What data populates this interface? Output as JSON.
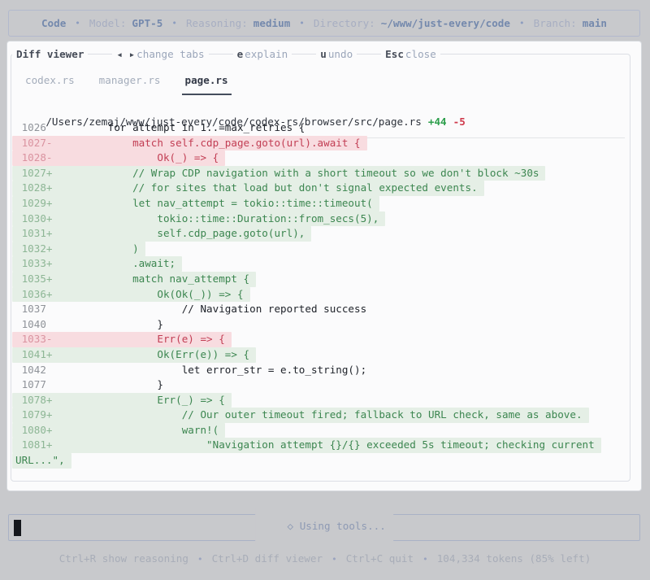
{
  "topbar": {
    "app": "Code",
    "bullet": "•",
    "items": [
      {
        "label": "Model:",
        "value": "GPT-5"
      },
      {
        "label": "Reasoning:",
        "value": "medium"
      },
      {
        "label": "Directory:",
        "value": "~/www/just-every/code"
      },
      {
        "label": "Branch:",
        "value": "main"
      }
    ]
  },
  "diff_viewer": {
    "title": "Diff viewer",
    "hints": [
      {
        "key": "◂ ▸",
        "label": "change tabs"
      },
      {
        "key": "e",
        "label": "explain"
      },
      {
        "key": "u",
        "label": "undo"
      },
      {
        "key": "Esc",
        "label": "close"
      }
    ],
    "tabs": [
      {
        "label": "codex.rs",
        "active": false
      },
      {
        "label": "manager.rs",
        "active": false
      },
      {
        "label": "page.rs",
        "active": true
      }
    ],
    "file_path": "/Users/zemaj/www/just-every/code/codex-rs/browser/src/page.rs",
    "additions": "+44",
    "deletions": "-5",
    "lines": [
      {
        "num": "1026",
        "sign": " ",
        "type": "ctx",
        "indent": 8,
        "code": "for attempt in 1..=max_retries {"
      },
      {
        "num": "1027",
        "sign": "-",
        "type": "del",
        "indent": 12,
        "code": "match self.cdp_page.goto(url).await {"
      },
      {
        "num": "1028",
        "sign": "-",
        "type": "del",
        "indent": 16,
        "code": "Ok(_) => {"
      },
      {
        "num": "1027",
        "sign": "+",
        "type": "add",
        "indent": 12,
        "code": "// Wrap CDP navigation with a short timeout so we don't block ~30s"
      },
      {
        "num": "1028",
        "sign": "+",
        "type": "add",
        "indent": 12,
        "code": "// for sites that load but don't signal expected events."
      },
      {
        "num": "1029",
        "sign": "+",
        "type": "add",
        "indent": 12,
        "code": "let nav_attempt = tokio::time::timeout("
      },
      {
        "num": "1030",
        "sign": "+",
        "type": "add",
        "indent": 16,
        "code": "tokio::time::Duration::from_secs(5),"
      },
      {
        "num": "1031",
        "sign": "+",
        "type": "add",
        "indent": 16,
        "code": "self.cdp_page.goto(url),"
      },
      {
        "num": "1032",
        "sign": "+",
        "type": "add",
        "indent": 12,
        "code": ")"
      },
      {
        "num": "1033",
        "sign": "+",
        "type": "add",
        "indent": 12,
        "code": ".await;"
      },
      {
        "num": "1035",
        "sign": "+",
        "type": "add",
        "indent": 12,
        "code": "match nav_attempt {"
      },
      {
        "num": "1036",
        "sign": "+",
        "type": "add",
        "indent": 16,
        "code": "Ok(Ok(_)) => {"
      },
      {
        "num": "1037",
        "sign": " ",
        "type": "ctx",
        "indent": 20,
        "code": "// Navigation reported success"
      },
      {
        "num": "1040",
        "sign": " ",
        "type": "ctx",
        "indent": 16,
        "code": "}"
      },
      {
        "num": "1033",
        "sign": "-",
        "type": "del",
        "indent": 16,
        "code": "Err(e) => {"
      },
      {
        "num": "1041",
        "sign": "+",
        "type": "add",
        "indent": 16,
        "code": "Ok(Err(e)) => {"
      },
      {
        "num": "1042",
        "sign": " ",
        "type": "ctx",
        "indent": 20,
        "code": "let error_str = e.to_string();"
      },
      {
        "num": "1077",
        "sign": " ",
        "type": "ctx",
        "indent": 16,
        "code": "}"
      },
      {
        "num": "1078",
        "sign": "+",
        "type": "add",
        "indent": 16,
        "code": "Err(_) => {"
      },
      {
        "num": "1079",
        "sign": "+",
        "type": "add",
        "indent": 20,
        "code": "// Our outer timeout fired; fallback to URL check, same as above."
      },
      {
        "num": "1080",
        "sign": "+",
        "type": "add",
        "indent": 20,
        "code": "warn!("
      },
      {
        "num": "1081",
        "sign": "+",
        "type": "add",
        "indent": 24,
        "code": "\"Navigation attempt {}/{} exceeded 5s timeout; checking current"
      },
      {
        "num": "",
        "sign": "",
        "type": "add",
        "indent": 0,
        "wrap": true,
        "code": "URL...\","
      }
    ]
  },
  "status": {
    "icon": "◇",
    "label": "Using tools..."
  },
  "footer": {
    "bullet": "•",
    "items": [
      "Ctrl+R show reasoning",
      "Ctrl+D diff viewer",
      "Ctrl+C quit",
      "104,334 tokens (85% left)"
    ]
  }
}
